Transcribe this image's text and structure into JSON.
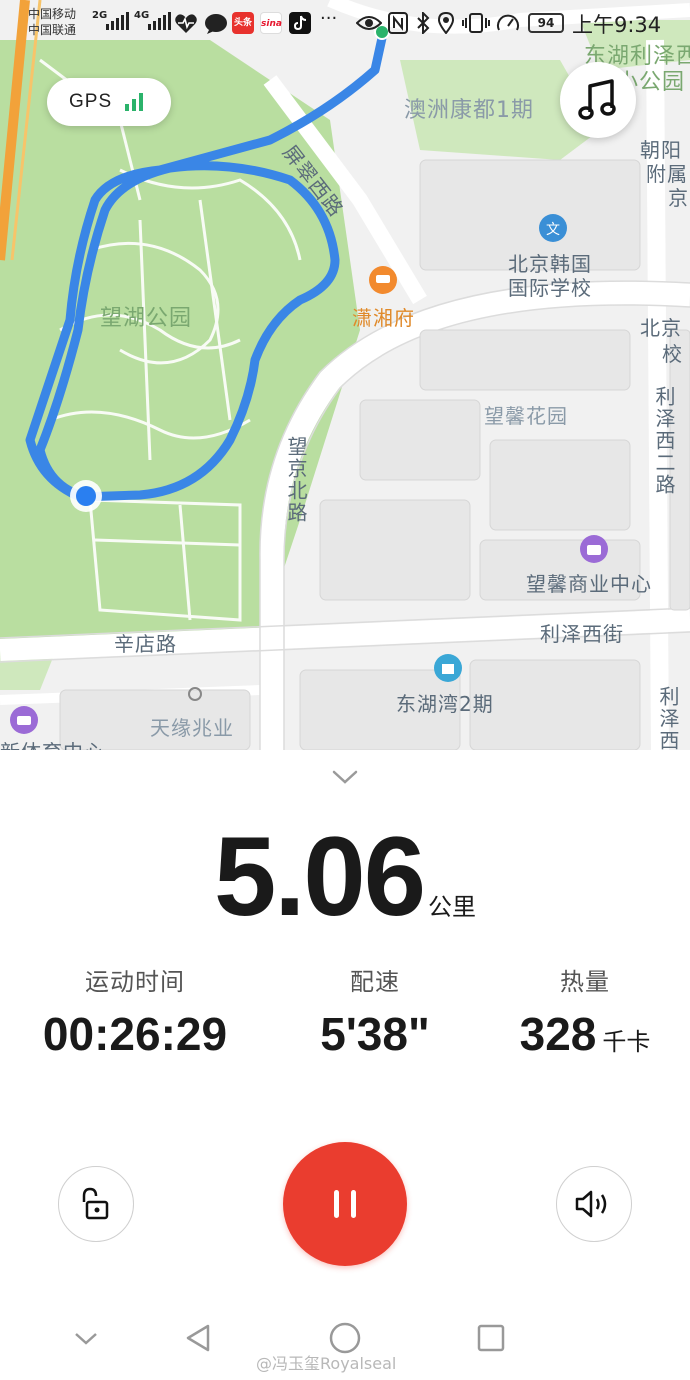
{
  "status_bar": {
    "carrier_1": "中国移动",
    "carrier_2": "中国联通",
    "net_1": "2G",
    "net_2": "4G",
    "app_icons": [
      {
        "name": "heart-rate-icon",
        "text": ""
      },
      {
        "name": "message-icon",
        "text": ""
      },
      {
        "name": "toutiao-icon",
        "text": "头条"
      },
      {
        "name": "sina-icon",
        "text": "sina"
      },
      {
        "name": "tiktok-icon",
        "text": ""
      }
    ],
    "more": "···",
    "battery": "94",
    "time": "上午9:34",
    "colors": {
      "toutiao": "#e8322d",
      "sina": "#e6162d",
      "tiktok": "#111111"
    }
  },
  "map": {
    "labels": {
      "donghu_park": "东湖利泽西",
      "donghu_park_2": "小公园",
      "aozhou": "澳洲康都1期",
      "chaoyang_1": "朝阳",
      "chaoyang_2": "附属",
      "chaoyang_3": "京",
      "pingcui_road": "屏翠西路",
      "korean_school_1": "北京韩国",
      "korean_school_2": "国际学校",
      "wanghu_park": "望湖公园",
      "xiaoxiangfu": "潇湘府",
      "beijing_side_1": "北京",
      "beijing_side_2": "校",
      "wangxin_garden": "望馨花园",
      "lize_west_2nd": "利泽西二路",
      "wangjing_north": "望京北路",
      "wangxin_center": "望馨商业中心",
      "xindian_road": "辛店路",
      "lize_west_street": "利泽西街",
      "donghuwan": "东湖湾2期",
      "tianyuan": "天缘兆业",
      "lize_side": "利泽西",
      "sports_center": "新体育中心"
    },
    "route_color": "#3a86e6",
    "park_color": "#b9dea0"
  },
  "gps_chip": {
    "label": "GPS",
    "signal_color": "#2bb36b"
  },
  "music_button": {
    "icon": "music-note-icon"
  },
  "workout": {
    "distance": "5.06",
    "distance_unit": "公里",
    "metrics": {
      "time_label": "运动时间",
      "time_value": "00:26:29",
      "pace_label": "配速",
      "pace_value": "5'38\"",
      "calories_label": "热量",
      "calories_value": "328",
      "calories_unit": "千卡"
    }
  },
  "controls": {
    "lock_icon": "unlock-icon",
    "pause_icon": "pause-icon",
    "sound_icon": "speaker-icon",
    "pause_color": "#ea3d2f"
  },
  "nav_bar": {
    "watermark": "@冯玉玺Royalseal",
    "buttons": [
      "chevron-down-icon",
      "back-icon",
      "home-icon",
      "recents-icon"
    ]
  }
}
